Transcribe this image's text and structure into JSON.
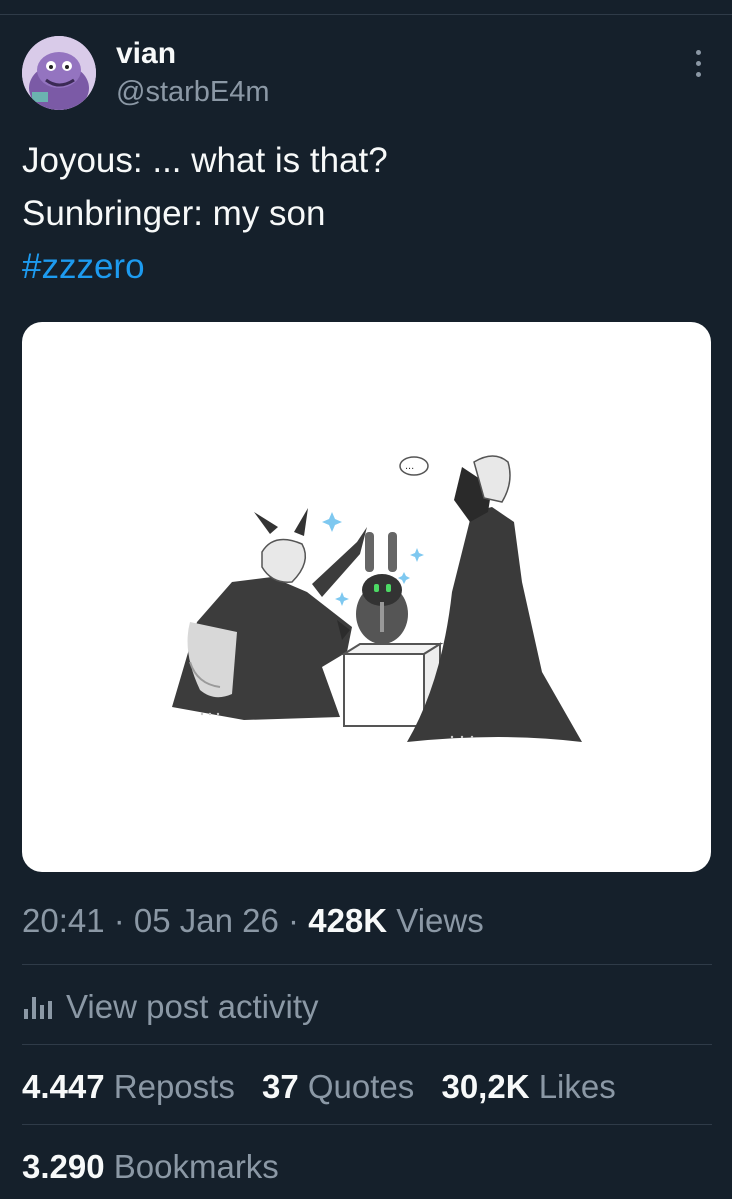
{
  "author": {
    "display_name": "vian",
    "handle": "@starbE4m"
  },
  "tweet": {
    "line1": "Joyous: ... what is that?",
    "line2": "Sunbringer: my son",
    "hashtag": "#zzzero"
  },
  "media": {
    "thought_bubble": "..."
  },
  "meta": {
    "time": "20:41",
    "sep1": " · ",
    "date": "05 Jan 26",
    "sep2": " · ",
    "views_count": "428K",
    "views_label": " Views"
  },
  "activity": {
    "label": "View post activity"
  },
  "stats": {
    "reposts_count": "4.447",
    "reposts_label": " Reposts",
    "quotes_count": "37",
    "quotes_label": " Quotes",
    "likes_count": "30,2K",
    "likes_label": " Likes",
    "bookmarks_count": "3.290",
    "bookmarks_label": " Bookmarks"
  },
  "colors": {
    "background": "#15202b",
    "text": "#f7f9f9",
    "secondary": "#8b98a5",
    "link": "#1d9bf0",
    "divider": "#2f3b48"
  }
}
